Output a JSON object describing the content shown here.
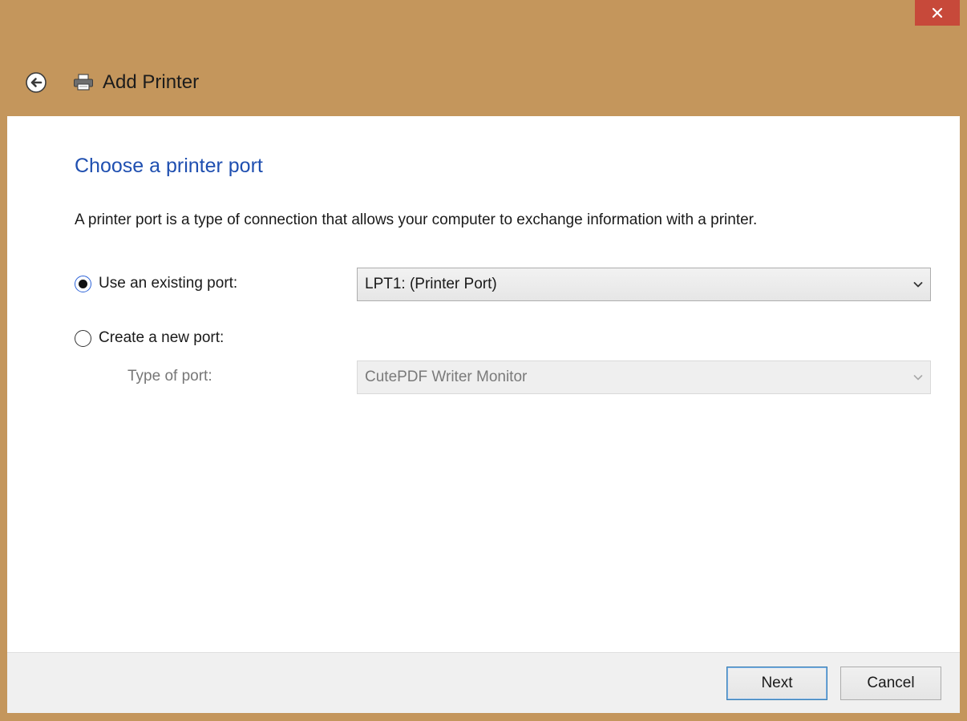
{
  "window": {
    "title": "Add Printer",
    "close_icon": "close-icon",
    "back_icon": "back-arrow-icon",
    "printer_icon": "printer-icon"
  },
  "page": {
    "heading": "Choose a printer port",
    "description": "A printer port is a type of connection that allows your computer to exchange information with a printer."
  },
  "options": {
    "existing_port_label": "Use an existing port:",
    "existing_port_checked": true,
    "existing_port_value": "LPT1: (Printer Port)",
    "new_port_label": "Create a new port:",
    "new_port_checked": false,
    "type_of_port_label": "Type of port:",
    "type_of_port_value": "CutePDF Writer Monitor",
    "type_of_port_enabled": false
  },
  "footer": {
    "next_label": "Next",
    "cancel_label": "Cancel"
  },
  "colors": {
    "frame": "#c4965c",
    "close_button": "#c7493a",
    "heading": "#1f4fb0"
  }
}
